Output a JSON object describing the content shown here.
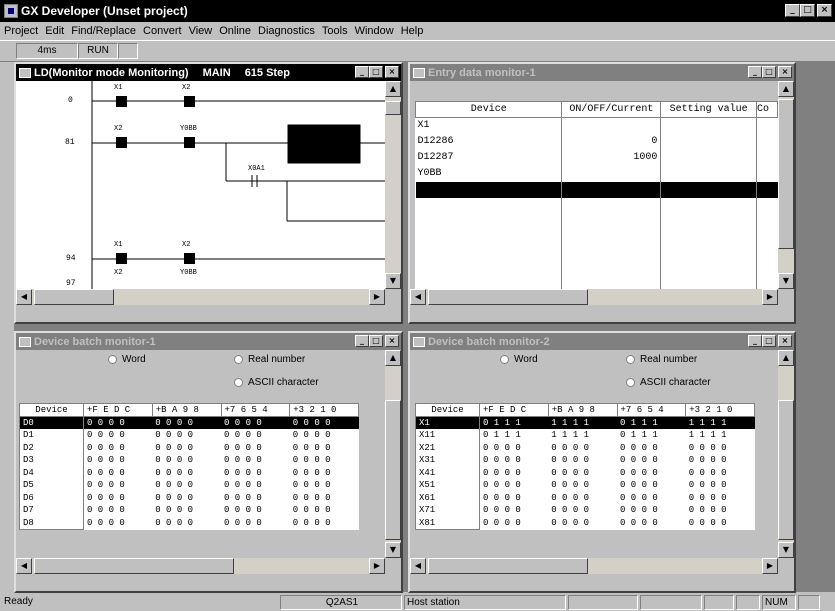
{
  "app": {
    "title": "GX Developer (Unset project)"
  },
  "menu": [
    "Project",
    "Edit",
    "Find/Replace",
    "Convert",
    "View",
    "Online",
    "Diagnostics",
    "Tools",
    "Window",
    "Help"
  ],
  "toolbar": {
    "scan_time": "4ms",
    "status": "RUN",
    "extra": ""
  },
  "ladder": {
    "title": "LD(Monitor mode Monitoring)",
    "program": "MAIN",
    "steps": "615 Step",
    "rungs": [
      {
        "step": "0",
        "contacts": [
          "X1",
          "X2"
        ]
      },
      {
        "step": "81",
        "contacts": [
          "X2",
          "Y0BB"
        ],
        "branch": "X0A1"
      },
      {
        "step": "94",
        "contacts": [
          "X1",
          "X2"
        ]
      },
      {
        "step": "97",
        "contacts": [
          "X2",
          "Y0BB"
        ]
      }
    ]
  },
  "entry": {
    "title": "Entry data monitor-1",
    "columns": [
      "Device",
      "ON/OFF/Current",
      "Setting value",
      "Co"
    ],
    "rows": [
      {
        "device": "X1",
        "current": "",
        "setting": ""
      },
      {
        "device": "D12286",
        "current": "0",
        "setting": ""
      },
      {
        "device": "D12287",
        "current": "1000",
        "setting": ""
      },
      {
        "device": "Y0BB",
        "current": "",
        "setting": ""
      },
      {
        "device": "",
        "current": "",
        "setting": ""
      }
    ]
  },
  "batch1": {
    "title": "Device batch monitor-1",
    "radio_word": "Word",
    "radio_real": "Real number",
    "radio_ascii": "ASCII character",
    "headers": [
      "Device",
      "+F E D C",
      "+B A 9 8",
      "+7 6 5 4",
      "+3 2 1 0"
    ],
    "rows": [
      {
        "device": "D0",
        "b": [
          "0 0 0 0",
          "0 0 0 0",
          "0 0 0 0",
          "0 0 0 0"
        ]
      },
      {
        "device": "D1",
        "b": [
          "0 0 0 0",
          "0 0 0 0",
          "0 0 0 0",
          "0 0 0 0"
        ]
      },
      {
        "device": "D2",
        "b": [
          "0 0 0 0",
          "0 0 0 0",
          "0 0 0 0",
          "0 0 0 0"
        ]
      },
      {
        "device": "D3",
        "b": [
          "0 0 0 0",
          "0 0 0 0",
          "0 0 0 0",
          "0 0 0 0"
        ]
      },
      {
        "device": "D4",
        "b": [
          "0 0 0 0",
          "0 0 0 0",
          "0 0 0 0",
          "0 0 0 0"
        ]
      },
      {
        "device": "D5",
        "b": [
          "0 0 0 0",
          "0 0 0 0",
          "0 0 0 0",
          "0 0 0 0"
        ]
      },
      {
        "device": "D6",
        "b": [
          "0 0 0 0",
          "0 0 0 0",
          "0 0 0 0",
          "0 0 0 0"
        ]
      },
      {
        "device": "D7",
        "b": [
          "0 0 0 0",
          "0 0 0 0",
          "0 0 0 0",
          "0 0 0 0"
        ]
      },
      {
        "device": "D8",
        "b": [
          "0 0 0 0",
          "0 0 0 0",
          "0 0 0 0",
          "0 0 0 0"
        ]
      }
    ]
  },
  "batch2": {
    "title": "Device batch monitor-2",
    "radio_word": "Word",
    "radio_real": "Real number",
    "radio_ascii": "ASCII character",
    "headers": [
      "Device",
      "+F E D C",
      "+B A 9 8",
      "+7 6 5 4",
      "+3 2 1 0"
    ],
    "rows": [
      {
        "device": "X1",
        "b": [
          "0 1 1 1",
          "1 1 1 1",
          "0 1 1 1",
          "1 1 1 1"
        ]
      },
      {
        "device": "X11",
        "b": [
          "0 1 1 1",
          "1 1 1 1",
          "0 1 1 1",
          "1 1 1 1"
        ]
      },
      {
        "device": "X21",
        "b": [
          "0 0 0 0",
          "0 0 0 0",
          "0 0 0 0",
          "0 0 0 0"
        ]
      },
      {
        "device": "X31",
        "b": [
          "0 0 0 0",
          "0 0 0 0",
          "0 0 0 0",
          "0 0 0 0"
        ]
      },
      {
        "device": "X41",
        "b": [
          "0 0 0 0",
          "0 0 0 0",
          "0 0 0 0",
          "0 0 0 0"
        ]
      },
      {
        "device": "X51",
        "b": [
          "0 0 0 0",
          "0 0 0 0",
          "0 0 0 0",
          "0 0 0 0"
        ]
      },
      {
        "device": "X61",
        "b": [
          "0 0 0 0",
          "0 0 0 0",
          "0 0 0 0",
          "0 0 0 0"
        ]
      },
      {
        "device": "X71",
        "b": [
          "0 0 0 0",
          "0 0 0 0",
          "0 0 0 0",
          "0 0 0 0"
        ]
      },
      {
        "device": "X81",
        "b": [
          "0 0 0 0",
          "0 0 0 0",
          "0 0 0 0",
          "0 0 0 0"
        ]
      }
    ]
  },
  "status": {
    "ready": "Ready",
    "cpu": "Q2AS1",
    "station": "Host station",
    "num": "NUM"
  }
}
